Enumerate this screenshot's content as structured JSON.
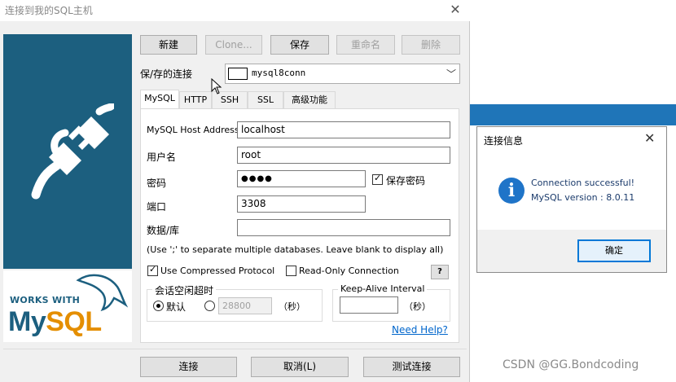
{
  "window": {
    "title": "连接到我的SQL主机"
  },
  "toolbar": {
    "new_label": "新建",
    "clone_label": "Clone...",
    "save_label": "保存",
    "rename_label": "重命名",
    "delete_label": "删除"
  },
  "saved_connection": {
    "label": "保/存的连接",
    "value": "mysql8conn"
  },
  "tabs": [
    {
      "label": "MySQL",
      "active": true
    },
    {
      "label": "HTTP"
    },
    {
      "label": "SSH"
    },
    {
      "label": "SSL"
    },
    {
      "label": "高级功能"
    }
  ],
  "form": {
    "host_label": "MySQL Host Address",
    "host_value": "localhost",
    "user_label": "用户名",
    "user_value": "root",
    "password_label": "密码",
    "password_value": "●●●●",
    "save_password_label": "保存密码",
    "save_password_checked": true,
    "port_label": "端口",
    "port_value": "3308",
    "database_label": "数据/库",
    "database_value": "",
    "database_hint": "(Use ';' to separate multiple databases. Leave blank to display all)",
    "compressed_label": "Use Compressed Protocol",
    "compressed_checked": true,
    "readonly_label": "Read-Only Connection",
    "readonly_checked": false,
    "help_label": "?",
    "timeout_group_label": "会话空闲超时",
    "timeout_default_label": "默认",
    "timeout_value": "28800",
    "timeout_unit": "（秒）",
    "keepalive_label": "Keep-Alive Interval",
    "keepalive_value": "",
    "keepalive_unit": "（秒）",
    "need_help_label": "Need Help?"
  },
  "footer": {
    "connect_label": "连接",
    "cancel_label": "取消(L)",
    "test_label": "测试连接"
  },
  "branding": {
    "works_with": "WORKS WITH",
    "mysql_my": "My",
    "mysql_sql": "SQL"
  },
  "info_dialog": {
    "title": "连接信息",
    "icon_char": "i",
    "message_line1": "Connection successful!",
    "message_line2": "MySQL version : 8.0.11",
    "ok_label": "确定"
  },
  "watermark": "CSDN @GG.Bondcoding",
  "colors": {
    "brand_blue": "#1c5f7f",
    "mysql_orange": "#e48e00",
    "info_blue": "#1f74c8",
    "link": "#0066cc"
  }
}
